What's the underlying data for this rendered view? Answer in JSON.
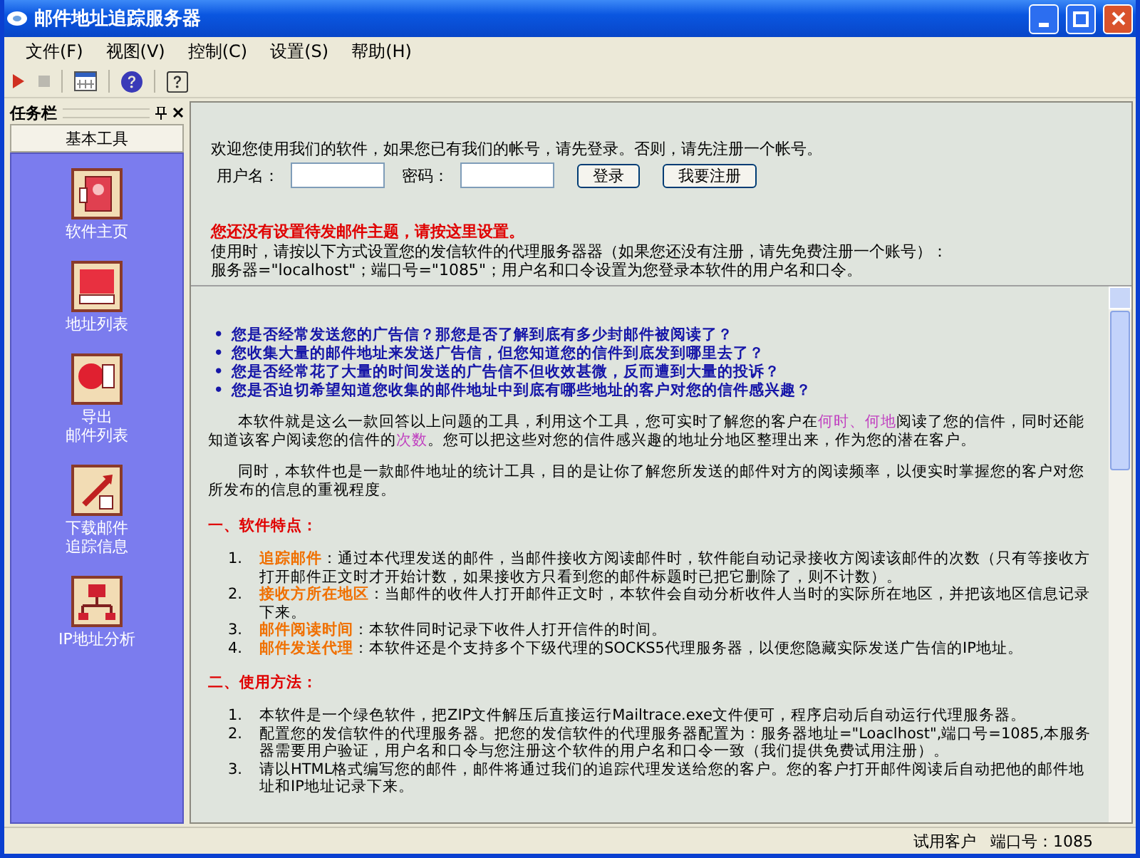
{
  "window": {
    "title": "邮件地址追踪服务器"
  },
  "menu": [
    "文件(F)",
    "视图(V)",
    "控制(C)",
    "设置(S)",
    "帮助(H)"
  ],
  "toolbar": [
    {
      "kind": "play",
      "disabled": false
    },
    {
      "kind": "stop",
      "disabled": true
    },
    {
      "kind": "grid",
      "disabled": false
    },
    {
      "kind": "help",
      "disabled": false
    },
    {
      "kind": "help-box",
      "disabled": false
    }
  ],
  "task_pane": {
    "title": "任务栏",
    "section": "基本工具",
    "items": [
      {
        "kind": "home",
        "lines": [
          "软件主页"
        ]
      },
      {
        "kind": "list",
        "lines": [
          "地址列表"
        ]
      },
      {
        "kind": "export",
        "lines": [
          "导出",
          "邮件列表"
        ]
      },
      {
        "kind": "download",
        "lines": [
          "下载邮件",
          "追踪信息"
        ]
      },
      {
        "kind": "ip",
        "lines": [
          "IP地址分析"
        ]
      }
    ]
  },
  "login": {
    "welcome": "欢迎您使用我们的软件，如果您已有我们的帐号，请先登录。否则，请先注册一个帐号。",
    "username_label": "用户名：",
    "password_label": "密码：",
    "buttons": [
      "登录",
      "我要注册"
    ]
  },
  "notice": {
    "warning": "您还没有设置待发邮件主题，请按这里设置。",
    "lines": [
      "使用时，请按以下方式设置您的发信软件的代理服务器器（如果您还没有注册，请先免费注册一个账号）：",
      "服务器=\"localhost\"；端口号=\"1085\"；用户名和口令设置为您登录本软件的用户名和口令。"
    ]
  },
  "article": {
    "questions": [
      {
        "marker": "•",
        "text": "您是否经常发送您的广告信？那您是否了解到底有多少封邮件被阅读了？"
      },
      {
        "marker": "•",
        "text": "您收集大量的邮件地址来发送广告信，但您知道您的信件到底发到哪里去了？"
      },
      {
        "marker": "•",
        "text": "您是否经常花了大量的时间发送的广告信不但收效甚微，反而遭到大量的投诉？"
      },
      {
        "marker": "•",
        "text": "您是否迫切希望知道您收集的邮件地址中到底有哪些地址的客户对您的信件感兴趣？"
      }
    ],
    "paragraphs": [
      [
        {
          "kind": "plain",
          "text": "本软件就是这么一款回答以上问题的工具，利用这个工具，您可实时了解您的客户在"
        },
        {
          "kind": "highlight",
          "text": "何时、何地"
        },
        {
          "kind": "plain",
          "text": "阅读了您的信件，同时还能知道该客户阅读您的信件的"
        },
        {
          "kind": "highlight",
          "text": "次数"
        },
        {
          "kind": "plain",
          "text": "。您可以把这些对您的信件感兴趣的地址分地区整理出来，作为您的潜在客户。"
        }
      ],
      [
        {
          "kind": "plain",
          "text": "同时，本软件也是一款邮件地址的统计工具，目的是让你了解您所发送的邮件对方的阅读频率，以便实时掌握您的客户对您所发布的信息的重视程度。"
        }
      ]
    ],
    "sections": [
      {
        "heading": "一、软件特点：",
        "items": [
          {
            "number": "1.",
            "label": "追踪邮件",
            "text": "：通过本代理发送的邮件，当邮件接收方阅读邮件时，软件能自动记录接收方阅读该邮件的次数（只有等接收方打开邮件正文时才开始计数，如果接收方只看到您的邮件标题时已把它删除了，则不计数）。"
          },
          {
            "number": "2.",
            "label": "接收方所在地区",
            "text": "：当邮件的收件人打开邮件正文时，本软件会自动分析收件人当时的实际所在地区，并把该地区信息记录下来。"
          },
          {
            "number": "3.",
            "label": "邮件阅读时间",
            "text": "：本软件同时记录下收件人打开信件的时间。"
          },
          {
            "number": "4.",
            "label": "邮件发送代理",
            "text": "：本软件还是个支持多个下级代理的SOCKS5代理服务器，以便您隐藏实际发送广告信的IP地址。"
          }
        ]
      },
      {
        "heading": "二、使用方法：",
        "items": [
          {
            "number": "1.",
            "text": "本软件是一个绿色软件，把ZIP文件解压后直接运行Mailtrace.exe文件便可，程序启动后自动运行代理服务器。"
          },
          {
            "number": "2.",
            "text": "配置您的发信软件的代理服务器。把您的发信软件的代理服务器配置为：服务器地址=\"Loaclhost\",端口号=1085,本服务器需要用户验证，用户名和口令与您注册这个软件的用户名和口令一致（我们提供免费试用注册）。"
          },
          {
            "number": "3.",
            "text": "请以HTML格式编写您的邮件，邮件将通过我们的追踪代理发送给您的客户。您的客户打开邮件阅读后自动把他的邮件地址和IP地址记录下来。"
          }
        ]
      }
    ]
  },
  "status_bar": {
    "user": "试用客户",
    "port": "端口号：1085"
  }
}
